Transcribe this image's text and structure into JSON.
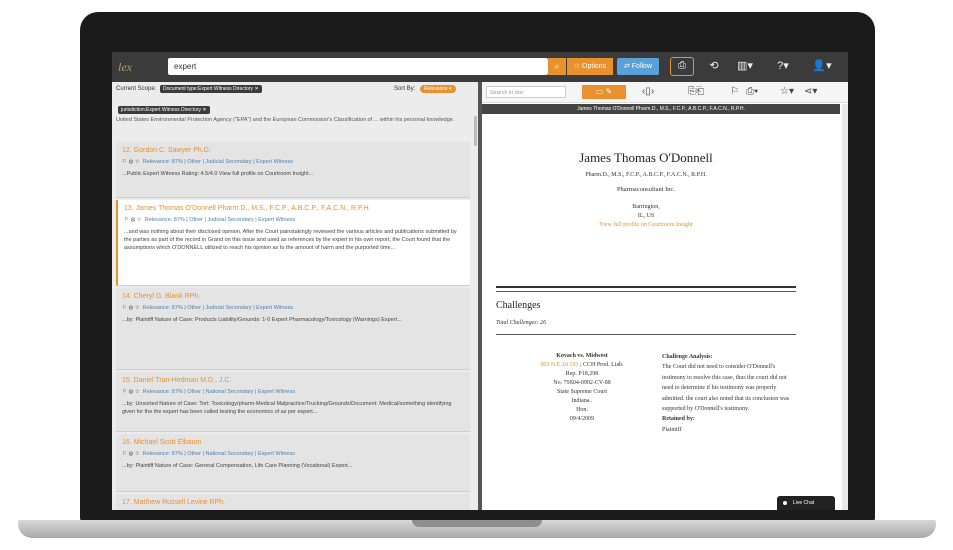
{
  "app": {
    "logo": "lex"
  },
  "topbar": {
    "search_value": "expert",
    "btn_orange_label": "☆ Options",
    "btn_blue_label": "⇄ Follow"
  },
  "left": {
    "scope_label": "Current Scope:",
    "scope_chip_1": "Document type:Expert Witness Directory  ✕",
    "scope_chip_2": "jurisdiction:Expert Witness Directory  ✕",
    "sort_label": "Sort By:",
    "sort_value": "Relevance ▾",
    "intro_snippet": "United States Environmental Protection Agency (\"EPA\") and the European Commission's Classification of ... within his personal knowledge.",
    "results": [
      {
        "title": "12. Gordon C. Sawyer Ph.D.",
        "meta": "Relevance: 87% | Other | Judicial Secondary | Expert Witness",
        "snippet": "...Public Expert Witness Rating: 4.5/4.0 View full profile on Courtroom Insight..."
      },
      {
        "title": "13. James Thomas O'Donnell Pharm.D., M.S., F.C.P., A.B.C.P., F.A.C.N., R.P.H.",
        "meta": "Relevance: 87% | Other | Judicial Secondary | Expert Witness",
        "snippet": "...and was nothing about their disclosed opinion. After the Court painstakingly reviewed the various articles and publications submitted by the parties as part of the record in Grand on this issue and used as references by the expert in his own report, the Court found that the assumptions which O'DONNELL utilized to reach his opinion as to the amount of harm and the purported time..."
      },
      {
        "title": "14. Cheryl G. Blank RPh.",
        "meta": "Relevance: 87% | Other | Judicial Secondary | Expert Witness",
        "snippet": "...by: Plaintiff Nature of Case: Products Liability/Grounds: 1-0 Expert Pharmacology/Toxicology (Warnings) Expert..."
      },
      {
        "title": "15. Daniel Tran-Hedman M.D., J.C.",
        "meta": "Relevance: 87% | Other | National Secondary | Expert Witness",
        "snippet": "...by: Unsorted Nature of Case: Tort: Toxicology/pharm-Medical Malpractice/Trucking/Grounds/Document: Medical/something identifying given for the the expert has been called testing the economics of as per expert..."
      },
      {
        "title": "16. Michael Scott Elbaum",
        "meta": "Relevance: 87% | Other | National Secondary | Expert Witness",
        "snippet": "...by: Plaintiff Nature of Case: General Compensation, Life Care Planning (Vocational) Expert..."
      },
      {
        "title": "17. Matthew Russell Levine RPh.",
        "meta": "",
        "snippet": ""
      }
    ]
  },
  "right": {
    "search_placeholder": "Search in doc",
    "doc_header": "James Thomas O'Donnell Pharm.D., M.S., F.C.P., A.B.C.P., F.A.C.N., R.P.H.",
    "name": "James Thomas O'Donnell",
    "credentials": "Pharm.D., M.S., F.C.P., A.B.C.P., F.A.C.N., R.P.H.",
    "firm": "Pharmaconsultant Inc.",
    "city": "Barrington,",
    "state": "IL, US",
    "profile_link": "View full profile on Courtroom Insight",
    "challenges_title": "Challenges",
    "total_challenges": "Total Challenges: 26",
    "case": {
      "title": "Kovach vs. Midwest",
      "cite": "903 N.E.2d 193",
      "line1": " ; CCH Prod. Liab.",
      "line2": "Rep. P18,298",
      "line3": "No. 79S04-0902-CV-88",
      "line4": "State Supreme Court",
      "line5": "Indiana .",
      "line6": "Hon.",
      "line7": "09/4/2009"
    },
    "analysis": {
      "title": "Challenge Analysis:",
      "text": "The Court did not need to consider O'Donnell's testimony to resolve this case, thus the court did not need to determine if his testimony was properly admitted. the court also noted that its conclusion was supported by O'Donnell's testimony.",
      "retained_label": "Retained by:",
      "retained_value": "Plaintiff"
    },
    "livechat": "Live Chat"
  }
}
